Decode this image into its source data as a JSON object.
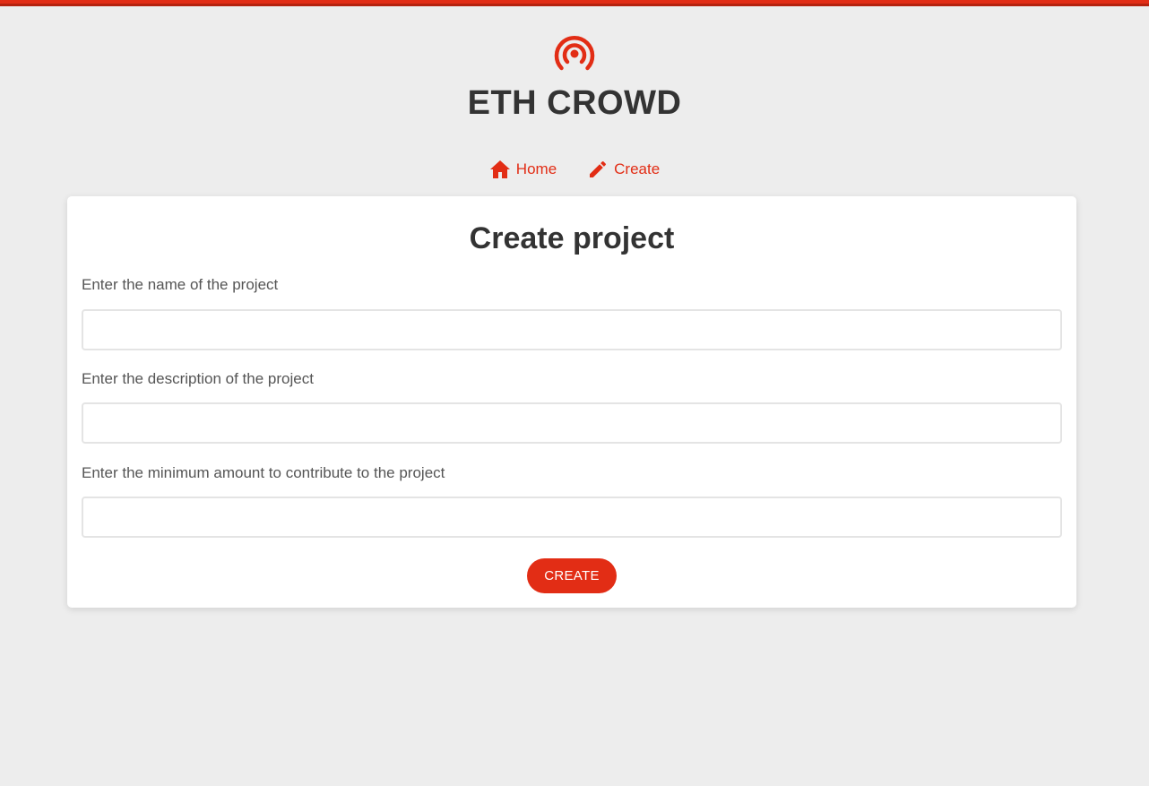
{
  "header": {
    "logo_icon": "broadcast-icon",
    "title": "ETH CROWD",
    "accent_color": "#e22d15"
  },
  "nav": {
    "items": [
      {
        "label": "Home",
        "icon": "home-icon"
      },
      {
        "label": "Create",
        "icon": "pencil-icon"
      }
    ]
  },
  "form": {
    "title": "Create project",
    "fields": [
      {
        "label": "Enter the name of the project",
        "value": "",
        "placeholder": ""
      },
      {
        "label": "Enter the description of the project",
        "value": "",
        "placeholder": ""
      },
      {
        "label": "Enter the minimum amount to contribute to the project",
        "value": "",
        "placeholder": ""
      }
    ],
    "submit_label": "CREATE"
  }
}
